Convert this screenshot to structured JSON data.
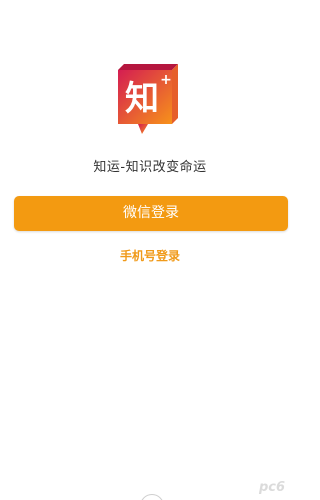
{
  "app": {
    "logo_char": "知",
    "logo_plus": "+",
    "tagline": "知运-知识改变命运"
  },
  "actions": {
    "wechat_login": "微信登录",
    "phone_login": "手机号登录"
  },
  "watermark": {
    "text": "pc6"
  },
  "colors": {
    "accent": "#f39a11",
    "logo_gradient_start": "#d41d52",
    "logo_gradient_end": "#f7921a"
  }
}
